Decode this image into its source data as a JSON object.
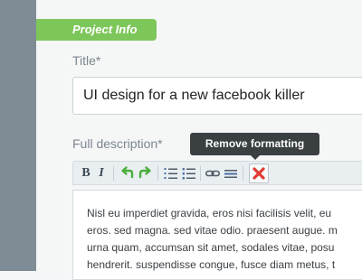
{
  "section": {
    "tab_label": "Project Info"
  },
  "fields": {
    "title_label": "Title*",
    "title_value": "UI design for a new facebook killer",
    "description_label": "Full description*"
  },
  "tooltip": {
    "text": "Remove formatting"
  },
  "toolbar": {
    "bold_label": "B",
    "italic_label": "I",
    "buttons": [
      "bold",
      "italic",
      "undo",
      "redo",
      "ordered-list",
      "unordered-list",
      "link",
      "horizontal-rule",
      "remove-formatting"
    ]
  },
  "editor": {
    "lines": [
      "Nisl eu imperdiet gravida, eros nisi facilisis velit, eu",
      "eros. sed magna. sed vitae odio. praesent augue. m",
      "urna quam, accumsan sit amet, sodales vitae, posu",
      "hendrerit. suspendisse congue, fusce diam metus, t"
    ]
  },
  "colors": {
    "accent_green": "#7dc65a",
    "rail": "#7f8c95",
    "tooltip_bg": "#3a3f42",
    "remove_x": "#e23b33"
  }
}
